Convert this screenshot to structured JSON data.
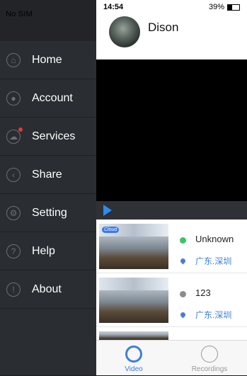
{
  "status": {
    "carrier": "No SIM",
    "time": "14:54",
    "battery": "39%"
  },
  "menu": {
    "items": [
      {
        "label": "Home",
        "icon": "home-icon"
      },
      {
        "label": "Account",
        "icon": "account-icon"
      },
      {
        "label": "Services",
        "icon": "services-icon",
        "badge": true
      },
      {
        "label": "Share",
        "icon": "share-icon"
      },
      {
        "label": "Setting",
        "icon": "gear-icon"
      },
      {
        "label": "Help",
        "icon": "help-icon"
      },
      {
        "label": "About",
        "icon": "info-icon"
      }
    ]
  },
  "profile": {
    "username": "Dison"
  },
  "cameras": [
    {
      "name": "Unknown",
      "location": "广东.深圳",
      "status_color": "#3cc36b",
      "cloud_label": "Cloud"
    },
    {
      "name": "123",
      "location": "广东.深圳",
      "status_color": "#8c8c8c"
    }
  ],
  "tabs": {
    "video": "Video",
    "recordings": "Recordings"
  },
  "colors": {
    "accent": "#3c7fd9"
  }
}
